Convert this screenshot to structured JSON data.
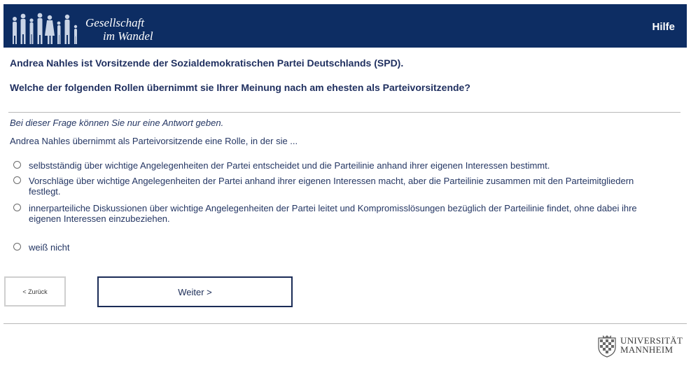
{
  "header": {
    "logo_line1": "Gesellschaft",
    "logo_line2": "im Wandel",
    "help_label": "Hilfe"
  },
  "question": {
    "intro": "Andrea Nahles ist Vorsitzende der Sozialdemokratischen Partei Deutschlands (SPD).",
    "text": "Welche der folgenden Rollen übernimmt sie Ihrer Meinung nach am ehesten als Parteivorsitzende?",
    "instruction": "Bei dieser Frage können Sie nur eine Antwort geben.",
    "stem": "Andrea Nahles übernimmt als Parteivorsitzende eine Rolle, in der sie ...",
    "options": [
      "selbstständig über wichtige Angelegenheiten der Partei entscheidet und die Parteilinie anhand ihrer eigenen Interessen bestimmt.",
      "Vorschläge über wichtige Angelegenheiten der Partei anhand ihrer eigenen Interessen macht, aber die Parteilinie zusammen mit den Parteimitgliedern festlegt.",
      "innerparteiliche Diskussionen über wichtige Angelegenheiten der Partei leitet und Kompromisslösungen bezüglich der Parteilinie findet, ohne dabei ihre eigenen Interessen einzubeziehen.",
      "weiß nicht"
    ]
  },
  "nav": {
    "back_label": "< Zurück",
    "next_label": "Weiter >"
  },
  "footer": {
    "uni_line1": "UNIVERSITÄT",
    "uni_line2": "MANNHEIM"
  },
  "colors": {
    "header_bg": "#0d2d63",
    "text": "#1f2f5f"
  }
}
